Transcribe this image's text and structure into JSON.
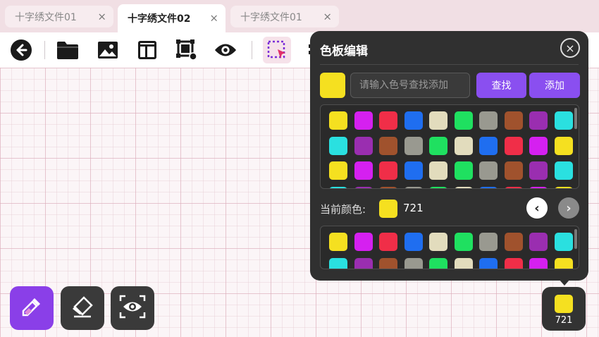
{
  "tabs": [
    {
      "label": "十字绣文件01",
      "active": false
    },
    {
      "label": "十字绣文件02",
      "active": true
    },
    {
      "label": "十字绣文件01",
      "active": false
    }
  ],
  "tab_close_glyph": "×",
  "toolbar": {
    "icons": [
      "back-arrow-icon",
      "folder-icon",
      "image-icon",
      "layout-icon",
      "crop-settings-icon",
      "eye-icon",
      "select-region-icon",
      "add-icon",
      "layer-icon",
      "cross-stitch-icon",
      "line-icon",
      "zigzag-icon",
      "crop-icon"
    ]
  },
  "palette_panel": {
    "title": "色板编辑",
    "close_glyph": "×",
    "search_placeholder": "请输入色号查找添加",
    "search_value": "",
    "search_swatch_color": "#f5e020",
    "find_label": "查找",
    "add_label": "添加",
    "current_color_label": "当前颜色:",
    "current_color_code": "721",
    "current_color": "#f5e020",
    "prev_glyph": "‹",
    "next_glyph": "›"
  },
  "palette_rows_top": [
    [
      "#f5e020",
      "#d520f0",
      "#f02e48",
      "#1f6ef0",
      "#e2dcbd",
      "#1fe060",
      "#999990",
      "#a0522d",
      "#9a2eb0",
      "#2ae0e0"
    ],
    [
      "#2ae0e0",
      "#9a2eb0",
      "#a0522d",
      "#999990",
      "#1fe060",
      "#e2dcbd",
      "#1f6ef0",
      "#f02e48",
      "#d520f0",
      "#f5e020"
    ],
    [
      "#f5e020",
      "#d520f0",
      "#f02e48",
      "#1f6ef0",
      "#e2dcbd",
      "#1fe060",
      "#999990",
      "#a0522d",
      "#9a2eb0",
      "#2ae0e0"
    ],
    [
      "#2ae0e0",
      "#9a2eb0",
      "#a0522d",
      "#999990",
      "#1fe060",
      "#e2dcbd",
      "#1f6ef0",
      "#f02e48",
      "#d520f0",
      "#f5e020"
    ]
  ],
  "palette_rows_bottom": [
    [
      "#f5e020",
      "#d520f0",
      "#f02e48",
      "#1f6ef0",
      "#e2dcbd",
      "#1fe060",
      "#999990",
      "#a0522d",
      "#9a2eb0",
      "#2ae0e0"
    ],
    [
      "#2ae0e0",
      "#9a2eb0",
      "#a0522d",
      "#999990",
      "#1fe060",
      "#e2dcbd",
      "#1f6ef0",
      "#f02e48",
      "#d520f0",
      "#f5e020"
    ]
  ],
  "bottom_tools": [
    "eyedropper-icon",
    "eraser-icon",
    "scan-view-icon"
  ],
  "current_color_button": {
    "code": "721",
    "color": "#f5e020"
  }
}
